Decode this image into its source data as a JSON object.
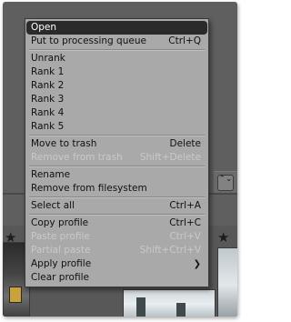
{
  "menu": {
    "items": [
      {
        "label": "Open",
        "shortcut": "",
        "disabled": false,
        "selected": true
      },
      {
        "label": "Put to processing queue",
        "shortcut": "Ctrl+Q",
        "disabled": false
      },
      {
        "separator": true
      },
      {
        "label": "Unrank",
        "shortcut": "",
        "disabled": false
      },
      {
        "label": "Rank 1",
        "shortcut": "",
        "disabled": false
      },
      {
        "label": "Rank 2",
        "shortcut": "",
        "disabled": false
      },
      {
        "label": "Rank 3",
        "shortcut": "",
        "disabled": false
      },
      {
        "label": "Rank 4",
        "shortcut": "",
        "disabled": false
      },
      {
        "label": "Rank 5",
        "shortcut": "",
        "disabled": false
      },
      {
        "separator": true
      },
      {
        "label": "Move to trash",
        "shortcut": "Delete",
        "disabled": false
      },
      {
        "label": "Remove from trash",
        "shortcut": "Shift+Delete",
        "disabled": true
      },
      {
        "separator": true
      },
      {
        "label": "Rename",
        "shortcut": "",
        "disabled": false
      },
      {
        "label": "Remove from filesystem",
        "shortcut": "",
        "disabled": false
      },
      {
        "separator": true
      },
      {
        "label": "Select all",
        "shortcut": "Ctrl+A",
        "disabled": false
      },
      {
        "separator": true
      },
      {
        "label": "Copy profile",
        "shortcut": "Ctrl+C",
        "disabled": false
      },
      {
        "label": "Paste profile",
        "shortcut": "Ctrl+V",
        "disabled": true
      },
      {
        "label": "Partial paste",
        "shortcut": "Shift+Ctrl+V",
        "disabled": true
      },
      {
        "label": "Apply profile",
        "shortcut": "",
        "disabled": false,
        "submenu": true
      },
      {
        "label": "Clear profile",
        "shortcut": "",
        "disabled": false
      }
    ]
  },
  "background": {
    "stepper_glyph": "⌃⌄",
    "star_glyph": "★"
  }
}
